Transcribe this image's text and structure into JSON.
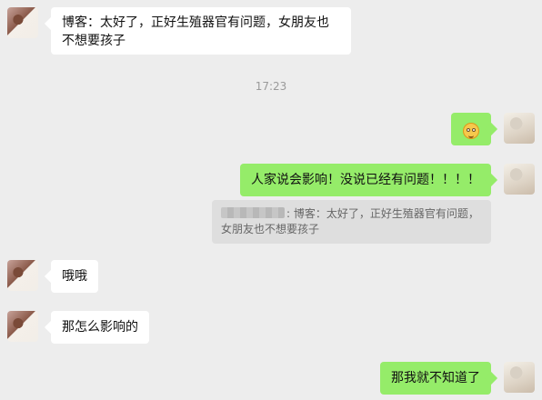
{
  "chat": {
    "timestamp": "17:23",
    "messages": [
      {
        "side": "left",
        "text": "博客：太好了，正好生殖器官有问题，女朋友也不想要孩子"
      },
      {
        "side": "right",
        "emoji": "flushed-face"
      },
      {
        "side": "right",
        "text": "人家说会影响！没说已经有问题！！！！"
      },
      {
        "side": "quote",
        "text": ": 博客：太好了，正好生殖器官有问题，女朋友也不想要孩子"
      },
      {
        "side": "left",
        "text": "哦哦"
      },
      {
        "side": "left",
        "text": "那怎么影响的"
      },
      {
        "side": "right",
        "text": "那我就不知道了"
      }
    ]
  }
}
